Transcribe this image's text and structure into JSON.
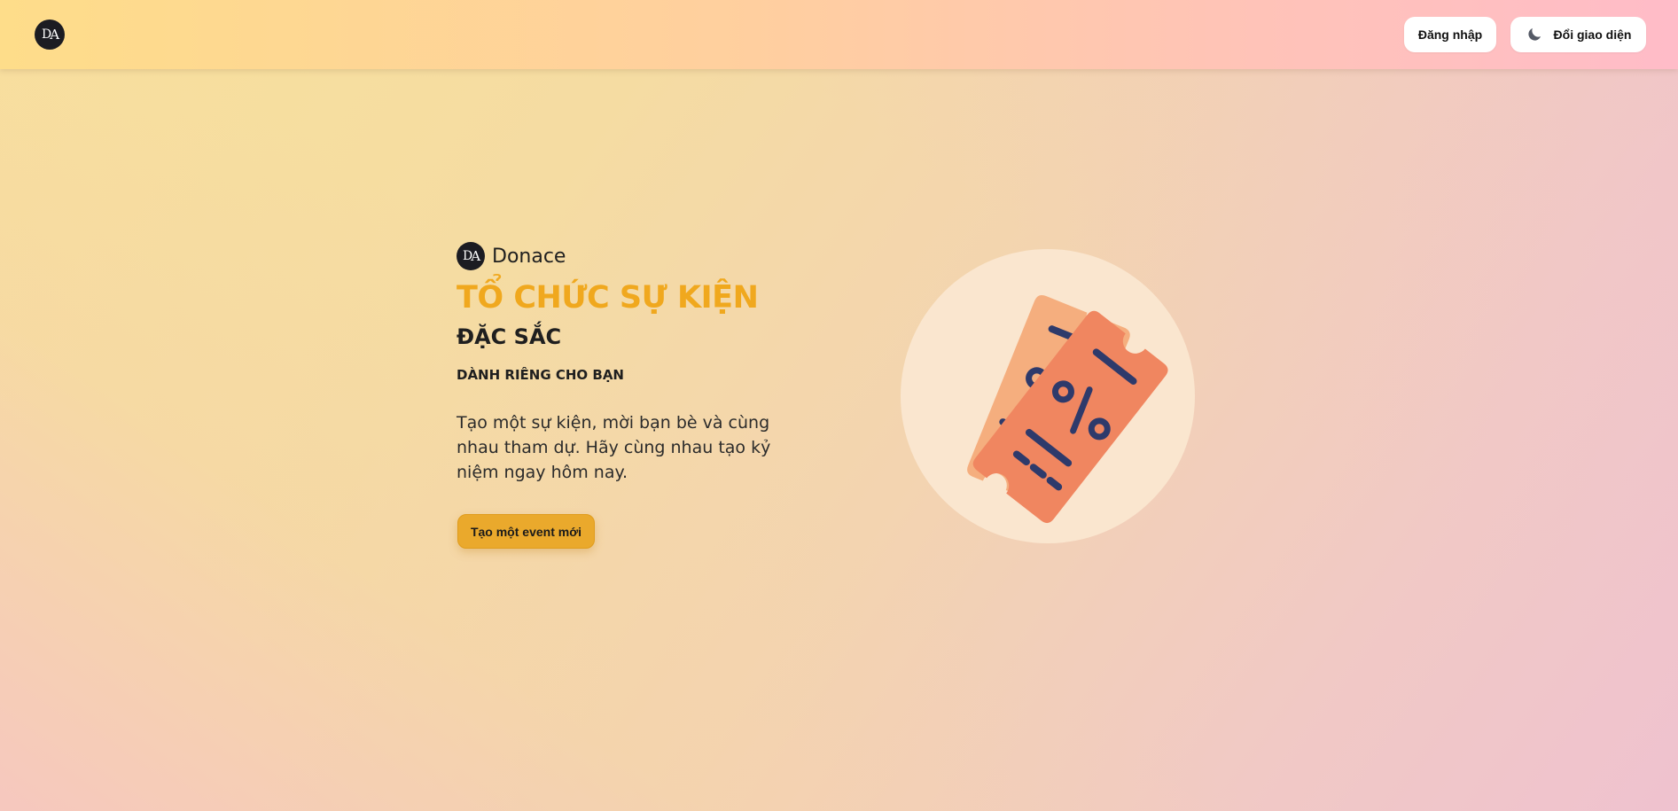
{
  "header": {
    "logo_text": "DA",
    "login_label": "Đăng nhập",
    "theme_label": "Đổi giao diện",
    "theme_icon": "moon-icon"
  },
  "hero": {
    "brand_name": "Donace",
    "title": "TỔ CHỨC SỰ KIỆN",
    "subtitle": "ĐẶC SẮC",
    "tagline": "DÀNH RIÊNG CHO BẠN",
    "description": "Tạo một sự kiện, mời bạn bè và cùng nhau tham dự. Hãy cùng nhau tạo kỷ niệm ngay hôm nay.",
    "cta_label": "Tạo một event mới",
    "illustration": "discount-tickets-icon"
  },
  "colors": {
    "accent": "#f0a81e",
    "cta": "#eaa92c",
    "ticket_back": "#f5ae7e",
    "ticket_front": "#f08660",
    "ticket_marks": "#2e3a6b",
    "circle": "#fae6cf"
  }
}
